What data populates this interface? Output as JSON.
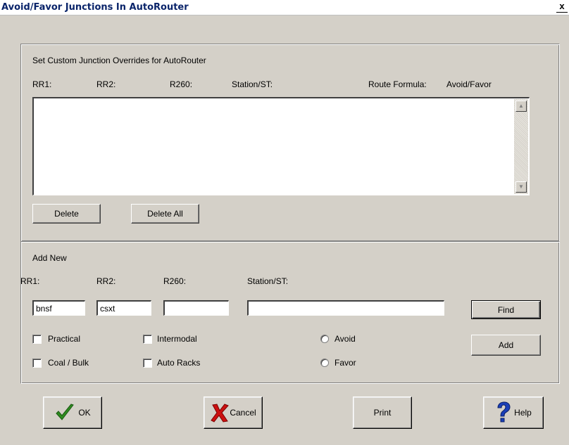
{
  "window": {
    "title": "Avoid/Favor Junctions In AutoRouter",
    "close_glyph": "x"
  },
  "overrides": {
    "group_label": "Set Custom Junction Overrides for AutoRouter",
    "columns": [
      "RR1:",
      "RR2:",
      "R260:",
      "Station/ST:",
      "Route Formula:",
      "Avoid/Favor"
    ],
    "rows": [],
    "delete_label": "Delete",
    "delete_all_label": "Delete All"
  },
  "add_new": {
    "group_label": "Add New",
    "rr1_label": "RR1:",
    "rr2_label": "RR2:",
    "r260_label": "R260:",
    "station_label": "Station/ST:",
    "rr1_value": "bnsf",
    "rr2_value": "csxt",
    "r260_value": "",
    "station_value": "",
    "find_label": "Find",
    "add_label": "Add",
    "practical_label": "Practical",
    "coal_bulk_label": "Coal / Bulk",
    "intermodal_label": "Intermodal",
    "auto_racks_label": "Auto Racks",
    "avoid_label": "Avoid",
    "favor_label": "Favor"
  },
  "footer": {
    "ok_label": "OK",
    "cancel_label": "Cancel",
    "print_label": "Print",
    "help_label": "Help"
  },
  "icons": {
    "ok": "checkmark-icon",
    "cancel": "red-x-icon",
    "help": "question-mark-icon"
  },
  "colors": {
    "checkmark": "#2e8b20",
    "cancel_x": "#cc1010",
    "help": "#1a3fb8",
    "title": "#0a246a"
  }
}
